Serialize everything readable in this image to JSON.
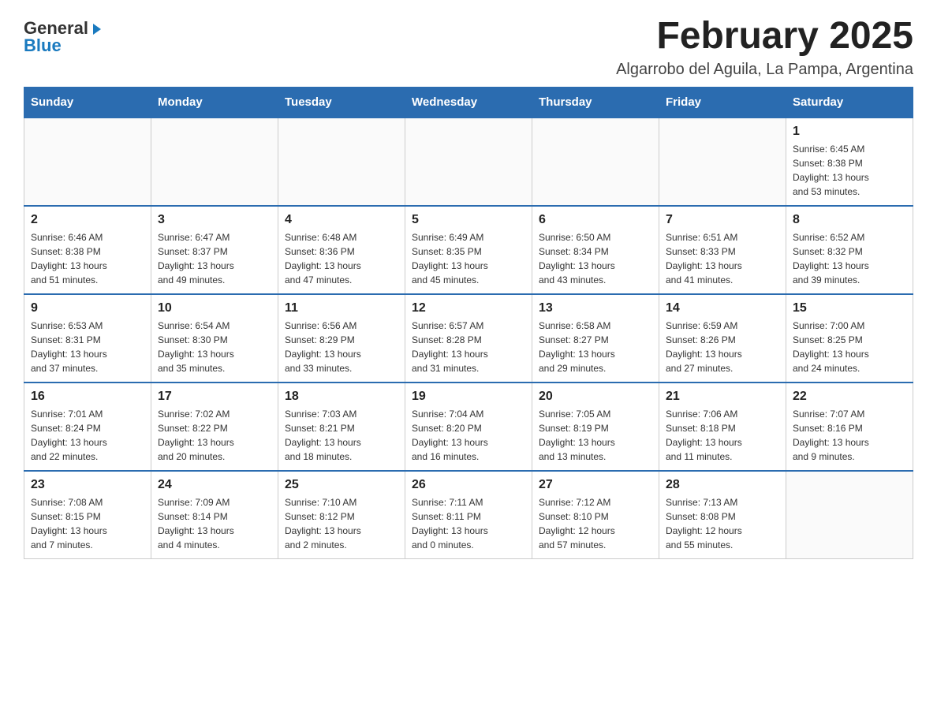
{
  "logo": {
    "general": "General",
    "blue": "Blue",
    "arrow": "▶"
  },
  "title": "February 2025",
  "location": "Algarrobo del Aguila, La Pampa, Argentina",
  "weekdays": [
    "Sunday",
    "Monday",
    "Tuesday",
    "Wednesday",
    "Thursday",
    "Friday",
    "Saturday"
  ],
  "weeks": [
    [
      {
        "day": "",
        "info": ""
      },
      {
        "day": "",
        "info": ""
      },
      {
        "day": "",
        "info": ""
      },
      {
        "day": "",
        "info": ""
      },
      {
        "day": "",
        "info": ""
      },
      {
        "day": "",
        "info": ""
      },
      {
        "day": "1",
        "info": "Sunrise: 6:45 AM\nSunset: 8:38 PM\nDaylight: 13 hours\nand 53 minutes."
      }
    ],
    [
      {
        "day": "2",
        "info": "Sunrise: 6:46 AM\nSunset: 8:38 PM\nDaylight: 13 hours\nand 51 minutes."
      },
      {
        "day": "3",
        "info": "Sunrise: 6:47 AM\nSunset: 8:37 PM\nDaylight: 13 hours\nand 49 minutes."
      },
      {
        "day": "4",
        "info": "Sunrise: 6:48 AM\nSunset: 8:36 PM\nDaylight: 13 hours\nand 47 minutes."
      },
      {
        "day": "5",
        "info": "Sunrise: 6:49 AM\nSunset: 8:35 PM\nDaylight: 13 hours\nand 45 minutes."
      },
      {
        "day": "6",
        "info": "Sunrise: 6:50 AM\nSunset: 8:34 PM\nDaylight: 13 hours\nand 43 minutes."
      },
      {
        "day": "7",
        "info": "Sunrise: 6:51 AM\nSunset: 8:33 PM\nDaylight: 13 hours\nand 41 minutes."
      },
      {
        "day": "8",
        "info": "Sunrise: 6:52 AM\nSunset: 8:32 PM\nDaylight: 13 hours\nand 39 minutes."
      }
    ],
    [
      {
        "day": "9",
        "info": "Sunrise: 6:53 AM\nSunset: 8:31 PM\nDaylight: 13 hours\nand 37 minutes."
      },
      {
        "day": "10",
        "info": "Sunrise: 6:54 AM\nSunset: 8:30 PM\nDaylight: 13 hours\nand 35 minutes."
      },
      {
        "day": "11",
        "info": "Sunrise: 6:56 AM\nSunset: 8:29 PM\nDaylight: 13 hours\nand 33 minutes."
      },
      {
        "day": "12",
        "info": "Sunrise: 6:57 AM\nSunset: 8:28 PM\nDaylight: 13 hours\nand 31 minutes."
      },
      {
        "day": "13",
        "info": "Sunrise: 6:58 AM\nSunset: 8:27 PM\nDaylight: 13 hours\nand 29 minutes."
      },
      {
        "day": "14",
        "info": "Sunrise: 6:59 AM\nSunset: 8:26 PM\nDaylight: 13 hours\nand 27 minutes."
      },
      {
        "day": "15",
        "info": "Sunrise: 7:00 AM\nSunset: 8:25 PM\nDaylight: 13 hours\nand 24 minutes."
      }
    ],
    [
      {
        "day": "16",
        "info": "Sunrise: 7:01 AM\nSunset: 8:24 PM\nDaylight: 13 hours\nand 22 minutes."
      },
      {
        "day": "17",
        "info": "Sunrise: 7:02 AM\nSunset: 8:22 PM\nDaylight: 13 hours\nand 20 minutes."
      },
      {
        "day": "18",
        "info": "Sunrise: 7:03 AM\nSunset: 8:21 PM\nDaylight: 13 hours\nand 18 minutes."
      },
      {
        "day": "19",
        "info": "Sunrise: 7:04 AM\nSunset: 8:20 PM\nDaylight: 13 hours\nand 16 minutes."
      },
      {
        "day": "20",
        "info": "Sunrise: 7:05 AM\nSunset: 8:19 PM\nDaylight: 13 hours\nand 13 minutes."
      },
      {
        "day": "21",
        "info": "Sunrise: 7:06 AM\nSunset: 8:18 PM\nDaylight: 13 hours\nand 11 minutes."
      },
      {
        "day": "22",
        "info": "Sunrise: 7:07 AM\nSunset: 8:16 PM\nDaylight: 13 hours\nand 9 minutes."
      }
    ],
    [
      {
        "day": "23",
        "info": "Sunrise: 7:08 AM\nSunset: 8:15 PM\nDaylight: 13 hours\nand 7 minutes."
      },
      {
        "day": "24",
        "info": "Sunrise: 7:09 AM\nSunset: 8:14 PM\nDaylight: 13 hours\nand 4 minutes."
      },
      {
        "day": "25",
        "info": "Sunrise: 7:10 AM\nSunset: 8:12 PM\nDaylight: 13 hours\nand 2 minutes."
      },
      {
        "day": "26",
        "info": "Sunrise: 7:11 AM\nSunset: 8:11 PM\nDaylight: 13 hours\nand 0 minutes."
      },
      {
        "day": "27",
        "info": "Sunrise: 7:12 AM\nSunset: 8:10 PM\nDaylight: 12 hours\nand 57 minutes."
      },
      {
        "day": "28",
        "info": "Sunrise: 7:13 AM\nSunset: 8:08 PM\nDaylight: 12 hours\nand 55 minutes."
      },
      {
        "day": "",
        "info": ""
      }
    ]
  ]
}
